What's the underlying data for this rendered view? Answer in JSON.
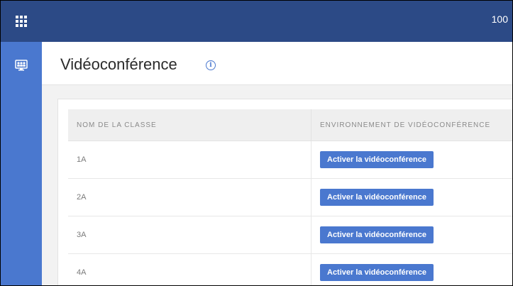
{
  "topbar": {
    "right_text": "100"
  },
  "sidebar": {
    "items": [
      {
        "icon": "videoconference-icon"
      }
    ]
  },
  "header": {
    "title": "Vidéoconférence",
    "info_icon": "i"
  },
  "table": {
    "columns": [
      "NOM DE LA CLASSE",
      "ENVIRONNEMENT DE VIDÉOCONFÉRENCE"
    ],
    "rows": [
      {
        "class": "1A",
        "action": "Activer la vidéoconférence"
      },
      {
        "class": "2A",
        "action": "Activer la vidéoconférence"
      },
      {
        "class": "3A",
        "action": "Activer la vidéoconférence"
      },
      {
        "class": "4A",
        "action": "Activer la vidéoconférence"
      }
    ]
  },
  "colors": {
    "topbar": "#2c4a86",
    "sidebar": "#4a78cf",
    "accent": "#4a78cf"
  }
}
